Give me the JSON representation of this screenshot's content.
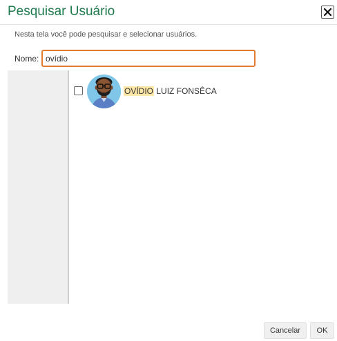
{
  "dialog": {
    "title": "Pesquisar Usuário",
    "description": "Nesta tela você pode pesquisar e selecionar usuários.",
    "close_icon": "close-icon"
  },
  "search": {
    "label": "Nome:",
    "value": "ovídio"
  },
  "results": [
    {
      "name_highlight": "OVÍDIO",
      "name_rest": " LUIZ FONSÊCA",
      "checked": false,
      "avatar": "user-avatar"
    }
  ],
  "buttons": {
    "cancel": "Cancelar",
    "ok": "OK"
  },
  "colors": {
    "title": "#1f7a4d",
    "input_focus": "#e07b2f",
    "highlight": "#fde6a6"
  }
}
